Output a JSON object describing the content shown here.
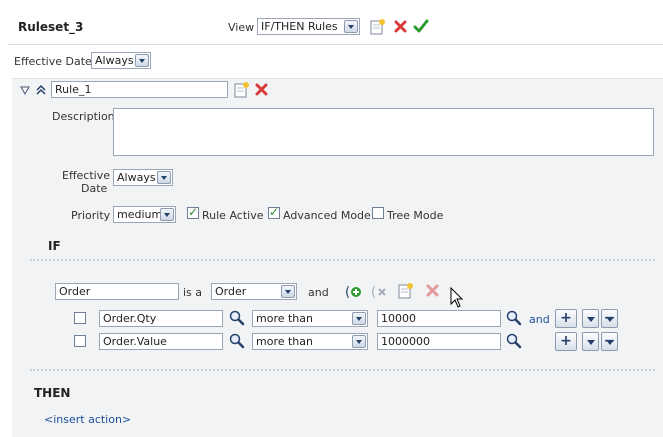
{
  "header": {
    "ruleset_title": "Ruleset_3",
    "view_label": "View",
    "view_value": "IF/THEN Rules"
  },
  "effective_date": {
    "label": "Effective Date",
    "value": "Always"
  },
  "rule": {
    "name": "Rule_1",
    "description_label": "Description",
    "description_value": "",
    "effective_date_label_1": "Effective",
    "effective_date_label_2": "Date",
    "effective_date_value": "Always",
    "priority_label": "Priority",
    "priority_value": "medium",
    "rule_active_label": "Rule Active",
    "advanced_mode_label": "Advanced Mode",
    "tree_mode_label": "Tree Mode",
    "rule_active": true,
    "advanced_mode": true,
    "tree_mode": false
  },
  "if_section": {
    "heading": "IF",
    "pattern_var": "Order",
    "is_a_label": "is a",
    "pattern_type": "Order",
    "and_label": "and",
    "tests": [
      {
        "left": "Order.Qty",
        "operator": "more than",
        "right": "10000",
        "connector": "and"
      },
      {
        "left": "Order.Value",
        "operator": "more than",
        "right": "1000000",
        "connector": ""
      }
    ]
  },
  "then_section": {
    "heading": "THEN",
    "insert_action": "<insert action>"
  },
  "colors": {
    "panel_bg": "#f2f3f5",
    "border": "#9aa5b6",
    "link": "#1e4f99",
    "delete_red": "#d83a3a",
    "ok_green": "#2c9a2c"
  }
}
